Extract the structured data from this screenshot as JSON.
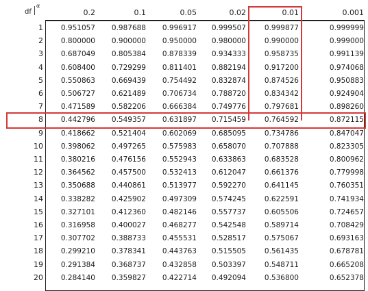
{
  "table": {
    "df_label": "df",
    "alpha_label": "α",
    "columns": [
      "0.2",
      "0.1",
      "0.05",
      "0.02",
      "0.01",
      "0.001"
    ],
    "rows": [
      {
        "df": "1",
        "values": [
          "0.951057",
          "0.987688",
          "0.996917",
          "0.999507",
          "0.999877",
          "0.999999"
        ]
      },
      {
        "df": "2",
        "values": [
          "0.800000",
          "0.900000",
          "0.950000",
          "0.980000",
          "0.990000",
          "0.999000"
        ]
      },
      {
        "df": "3",
        "values": [
          "0.687049",
          "0.805384",
          "0.878339",
          "0.934333",
          "0.958735",
          "0.991139"
        ]
      },
      {
        "df": "4",
        "values": [
          "0.608400",
          "0.729299",
          "0.811401",
          "0.882194",
          "0.917200",
          "0.974068"
        ]
      },
      {
        "df": "5",
        "values": [
          "0.550863",
          "0.669439",
          "0.754492",
          "0.832874",
          "0.874526",
          "0.950883"
        ]
      },
      {
        "df": "6",
        "values": [
          "0.506727",
          "0.621489",
          "0.706734",
          "0.788720",
          "0.834342",
          "0.924904"
        ]
      },
      {
        "df": "7",
        "values": [
          "0.471589",
          "0.582206",
          "0.666384",
          "0.749776",
          "0.797681",
          "0.898260"
        ]
      },
      {
        "df": "8",
        "values": [
          "0.442796",
          "0.549357",
          "0.631897",
          "0.715459",
          "0.764592",
          "0.872115"
        ]
      },
      {
        "df": "9",
        "values": [
          "0.418662",
          "0.521404",
          "0.602069",
          "0.685095",
          "0.734786",
          "0.847047"
        ]
      },
      {
        "df": "10",
        "values": [
          "0.398062",
          "0.497265",
          "0.575983",
          "0.658070",
          "0.707888",
          "0.823305"
        ]
      },
      {
        "df": "11",
        "values": [
          "0.380216",
          "0.476156",
          "0.552943",
          "0.633863",
          "0.683528",
          "0.800962"
        ]
      },
      {
        "df": "12",
        "values": [
          "0.364562",
          "0.457500",
          "0.532413",
          "0.612047",
          "0.661376",
          "0.779998"
        ]
      },
      {
        "df": "13",
        "values": [
          "0.350688",
          "0.440861",
          "0.513977",
          "0.592270",
          "0.641145",
          "0.760351"
        ]
      },
      {
        "df": "14",
        "values": [
          "0.338282",
          "0.425902",
          "0.497309",
          "0.574245",
          "0.622591",
          "0.741934"
        ]
      },
      {
        "df": "15",
        "values": [
          "0.327101",
          "0.412360",
          "0.482146",
          "0.557737",
          "0.605506",
          "0.724657"
        ]
      },
      {
        "df": "16",
        "values": [
          "0.316958",
          "0.400027",
          "0.468277",
          "0.542548",
          "0.589714",
          "0.708429"
        ]
      },
      {
        "df": "17",
        "values": [
          "0.307702",
          "0.388733",
          "0.455531",
          "0.528517",
          "0.575067",
          "0.693163"
        ]
      },
      {
        "df": "18",
        "values": [
          "0.299210",
          "0.378341",
          "0.443763",
          "0.515505",
          "0.561435",
          "0.678781"
        ]
      },
      {
        "df": "19",
        "values": [
          "0.291384",
          "0.368737",
          "0.432858",
          "0.503397",
          "0.548711",
          "0.665208"
        ]
      },
      {
        "df": "20",
        "values": [
          "0.284140",
          "0.359827",
          "0.422714",
          "0.492094",
          "0.536800",
          "0.652378"
        ]
      }
    ]
  },
  "highlight": {
    "column": "0.01",
    "row": "8",
    "color": "#d23a3a"
  }
}
